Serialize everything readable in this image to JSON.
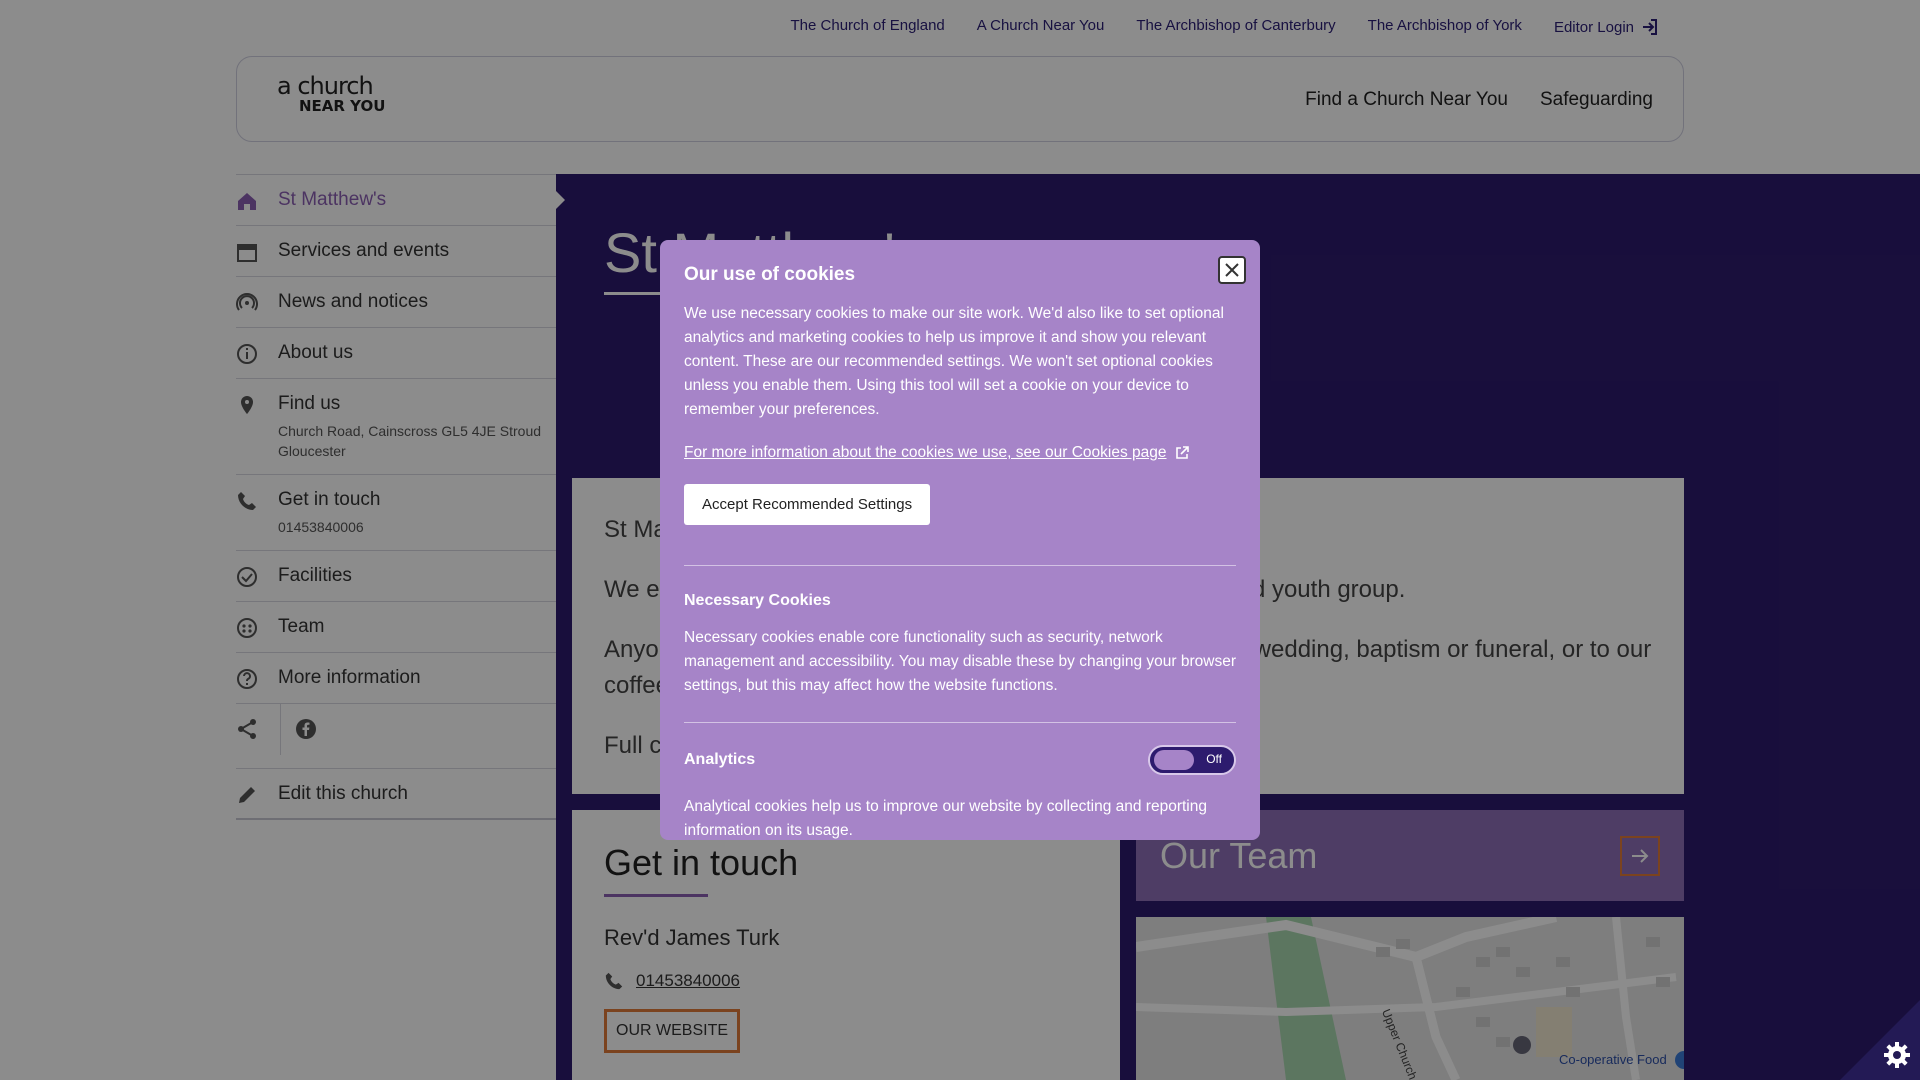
{
  "topbar": {
    "links": [
      "The Church of England",
      "A Church Near You",
      "The Archbishop of Canterbury",
      "The Archbishop of York"
    ],
    "login": "Editor Login",
    "login_icon": "login-arrow-icon"
  },
  "header": {
    "logo_line1": "a church",
    "logo_line2": "NEAR YOU",
    "nav": [
      "Find a Church Near You",
      "Safeguarding"
    ]
  },
  "sidebar": {
    "items": [
      {
        "label": "St Matthew's",
        "icon": "home-icon"
      },
      {
        "label": "Services and events",
        "icon": "calendar-icon"
      },
      {
        "label": "News and notices",
        "icon": "broadcast-icon"
      },
      {
        "label": "About us",
        "icon": "info-icon"
      },
      {
        "label": "Find us",
        "sub": "Church Road, Cainscross GL5 4JE Stroud Gloucester",
        "icon": "map-pin-icon"
      },
      {
        "label": "Get in touch",
        "sub": "01453840006",
        "icon": "phone-icon"
      },
      {
        "label": "Facilities",
        "icon": "check-circle-icon"
      },
      {
        "label": "Team",
        "icon": "team-icon"
      },
      {
        "label": "More information",
        "icon": "question-icon"
      },
      {
        "label": "Edit this church",
        "icon": "pencil-icon"
      }
    ],
    "share_icons": [
      "share-icon",
      "facebook-icon"
    ]
  },
  "main": {
    "title": "St Matthew's",
    "intro": [
      "St Matthew's is the parish church of Cainscross, Stroud.",
      "We enjoy a thriving Sunday school, toddler group, homes, and youth group.",
      "Anyone is welcome to come along to a Sunday service, for a wedding, baptism or funeral, or to our coffee mornings?",
      "Full contact details: www.fivevalleysparishchurches.org.uk/"
    ],
    "get_in_touch": {
      "heading": "Get in touch",
      "name": "Rev'd James Turk",
      "phone": "01453840006",
      "website_label": "OUR WEBSITE"
    },
    "team": {
      "heading": "Our Team"
    },
    "map": {
      "labels": [
        "Upper Church Rd",
        "Co-operative Food"
      ]
    }
  },
  "cookies": {
    "title": "Our use of cookies",
    "intro": "We use necessary cookies to make our site work. We'd also like to set optional analytics and marketing cookies to help us improve it and show you relevant content. These are our recommended settings. We won't set optional cookies unless you enable them. Using this tool will set a cookie on your device to remember your preferences.",
    "more_link": "For more information about the cookies we use, see our Cookies page",
    "accept_button": "Accept Recommended Settings",
    "necessary_title": "Necessary Cookies",
    "necessary_text": "Necessary cookies enable core functionality such as security, network management and accessibility. You may disable these by changing your browser settings, but this may affect how the website functions.",
    "analytics_title": "Analytics",
    "analytics_state": "Off",
    "analytics_on": false,
    "analytics_text": "Analytical cookies help us to improve our website by collecting and reporting information on its usage."
  },
  "colors": {
    "brand_purple": "#2d1b6e",
    "light_purple": "#a684c8",
    "accent_orange": "#e07b39"
  }
}
